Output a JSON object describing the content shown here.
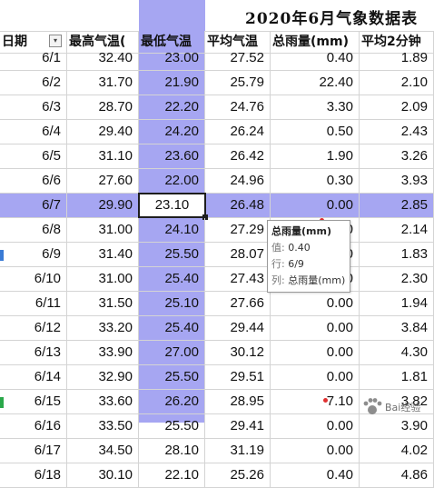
{
  "title": "2020年6月气象数据表",
  "headers": [
    "日期",
    "最高气温(",
    "最低气温",
    "平均气温",
    "总雨量(mm)",
    "平均2分钟"
  ],
  "filter_icon": "filter-dropdown-icon",
  "rows": [
    [
      "6/1",
      "32.40",
      "23.00",
      "27.52",
      "0.40",
      "1.89"
    ],
    [
      "6/2",
      "31.70",
      "21.90",
      "25.79",
      "22.40",
      "2.10"
    ],
    [
      "6/3",
      "28.70",
      "22.20",
      "24.76",
      "3.30",
      "2.09"
    ],
    [
      "6/4",
      "29.40",
      "24.20",
      "26.24",
      "0.50",
      "2.43"
    ],
    [
      "6/5",
      "31.10",
      "23.60",
      "26.42",
      "1.90",
      "3.26"
    ],
    [
      "6/6",
      "27.60",
      "22.00",
      "24.96",
      "0.30",
      "3.93"
    ],
    [
      "6/7",
      "29.90",
      "23.10",
      "26.48",
      "0.00",
      "2.85"
    ],
    [
      "6/8",
      "31.00",
      "24.10",
      "27.29",
      "0.00",
      "2.14"
    ],
    [
      "6/9",
      "31.40",
      "25.50",
      "28.07",
      "0.40",
      "1.83"
    ],
    [
      "6/10",
      "31.00",
      "25.40",
      "27.43",
      "0.00",
      "2.30"
    ],
    [
      "6/11",
      "31.50",
      "25.10",
      "27.66",
      "0.00",
      "1.94"
    ],
    [
      "6/12",
      "33.20",
      "25.40",
      "29.44",
      "0.00",
      "3.84"
    ],
    [
      "6/13",
      "33.90",
      "27.00",
      "30.12",
      "0.00",
      "4.30"
    ],
    [
      "6/14",
      "32.90",
      "25.50",
      "29.51",
      "0.00",
      "1.81"
    ],
    [
      "6/15",
      "33.60",
      "26.20",
      "28.95",
      "7.10",
      "3.82"
    ],
    [
      "6/16",
      "33.50",
      "25.50",
      "29.41",
      "0.00",
      "3.90"
    ],
    [
      "6/17",
      "34.50",
      "28.10",
      "31.19",
      "0.00",
      "4.02"
    ],
    [
      "6/18",
      "30.10",
      "22.10",
      "25.26",
      "0.40",
      "4.86"
    ]
  ],
  "selection": {
    "row_date": "6/7",
    "active_value": "23.10",
    "highlight_color": "#a6a6f2"
  },
  "tooltip": {
    "title": "总雨量(mm)",
    "value_key": "值:",
    "value": "0.40",
    "row_key": "行:",
    "row": "6/9",
    "col_key": "列:",
    "col": "总雨量(mm)"
  },
  "watermark": {
    "text": "Bai经验"
  }
}
